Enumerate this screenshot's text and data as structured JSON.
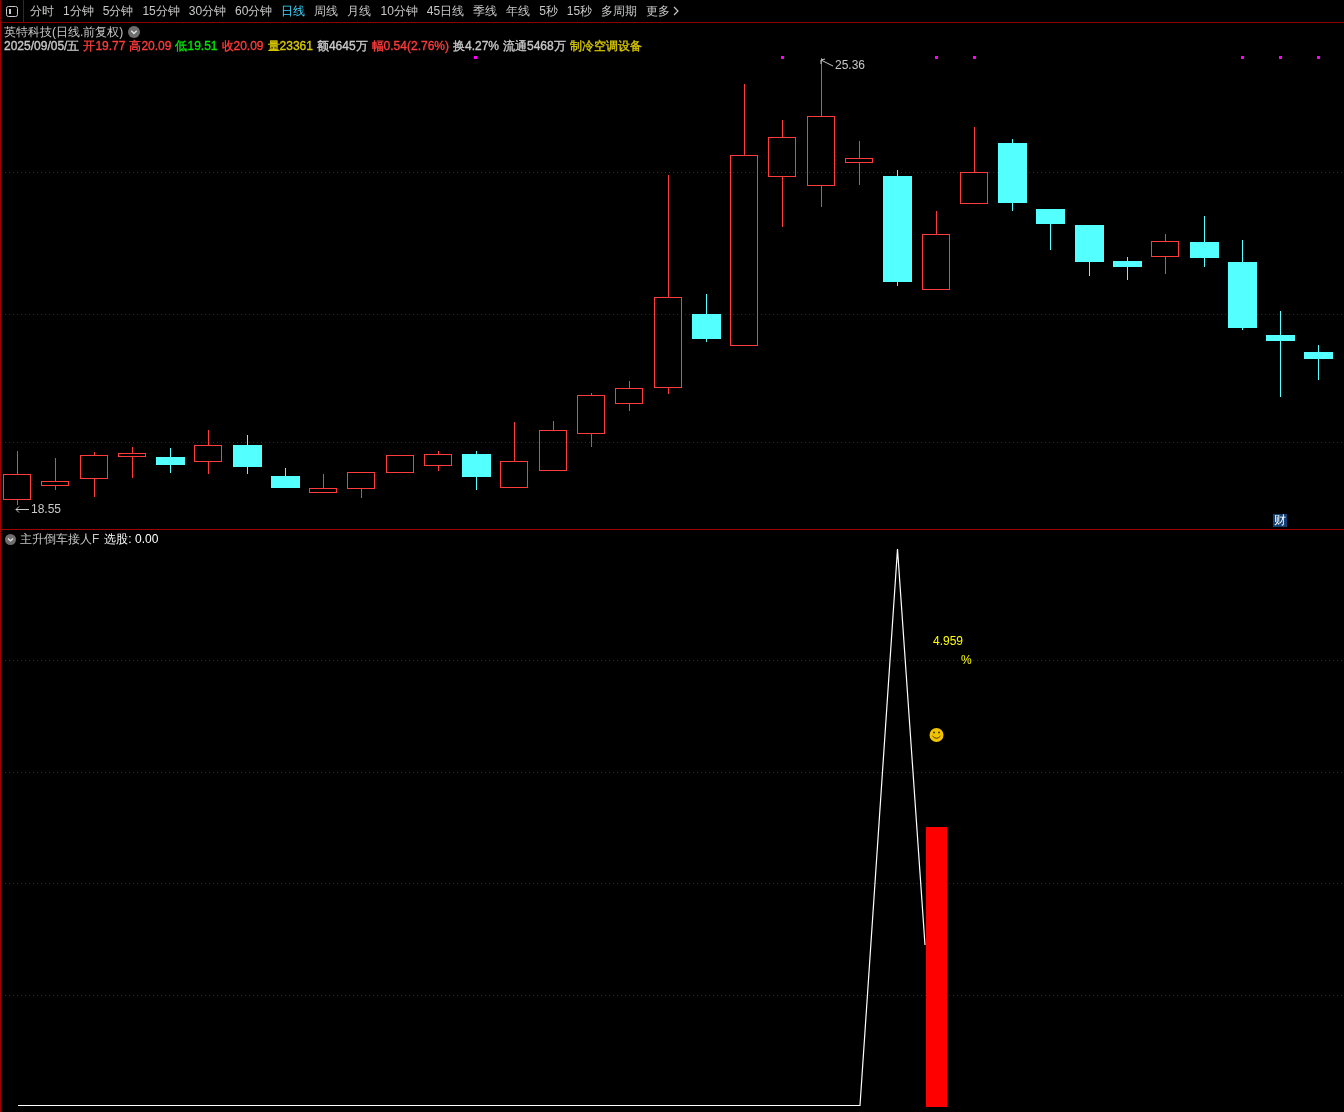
{
  "toolbar": {
    "items": [
      {
        "label": "分时",
        "kind": "period",
        "selected": false
      },
      {
        "label": "1分钟",
        "kind": "period",
        "selected": false
      },
      {
        "label": "5分钟",
        "kind": "period",
        "selected": false
      },
      {
        "label": "15分钟",
        "kind": "period",
        "selected": false
      },
      {
        "label": "30分钟",
        "kind": "period",
        "selected": false
      },
      {
        "label": "60分钟",
        "kind": "period",
        "selected": false
      },
      {
        "label": "日线",
        "kind": "period",
        "selected": true
      },
      {
        "label": "周线",
        "kind": "period",
        "selected": false
      },
      {
        "label": "月线",
        "kind": "period",
        "selected": false
      },
      {
        "label": "10分钟",
        "kind": "period",
        "selected": false
      },
      {
        "label": "45日线",
        "kind": "period",
        "selected": false
      },
      {
        "label": "季线",
        "kind": "period",
        "selected": false
      },
      {
        "label": "年线",
        "kind": "period",
        "selected": false
      },
      {
        "label": "5秒",
        "kind": "period",
        "selected": false
      },
      {
        "label": "15秒",
        "kind": "period",
        "selected": false
      },
      {
        "label": "多周期",
        "kind": "period",
        "selected": false
      },
      {
        "label": "更多",
        "kind": "more",
        "selected": false
      }
    ]
  },
  "main_chart": {
    "title": "英特科技(日线.前复权)",
    "quote": [
      {
        "text": "2025/09/05/五",
        "color": "#c8c8c8"
      },
      {
        "text": "开19.77",
        "color": "#ff3c3c"
      },
      {
        "text": "高20.09",
        "color": "#ff3c3c"
      },
      {
        "text": "低19.51",
        "color": "#00e600"
      },
      {
        "text": "收20.09",
        "color": "#ff3c3c"
      },
      {
        "text": "量23361",
        "color": "#d8c800"
      },
      {
        "text": "额4645万",
        "color": "#c8c8c8"
      },
      {
        "text": "幅0.54(2.76%)",
        "color": "#ff3c3c"
      },
      {
        "text": "换4.27%",
        "color": "#c8c8c8"
      },
      {
        "text": "流通5468万",
        "color": "#c8c8c8"
      },
      {
        "text": "制冷空调设备",
        "color": "#d8c800"
      }
    ],
    "price_labels": [
      {
        "kind": "low",
        "text": "18.55"
      },
      {
        "kind": "high",
        "text": "25.36"
      }
    ],
    "badge": "财"
  },
  "indicator_panel": {
    "title": "主升倒车接人F",
    "readout": "选股: 0.00",
    "value_label": "4.959",
    "unit_label": "%"
  }
}
